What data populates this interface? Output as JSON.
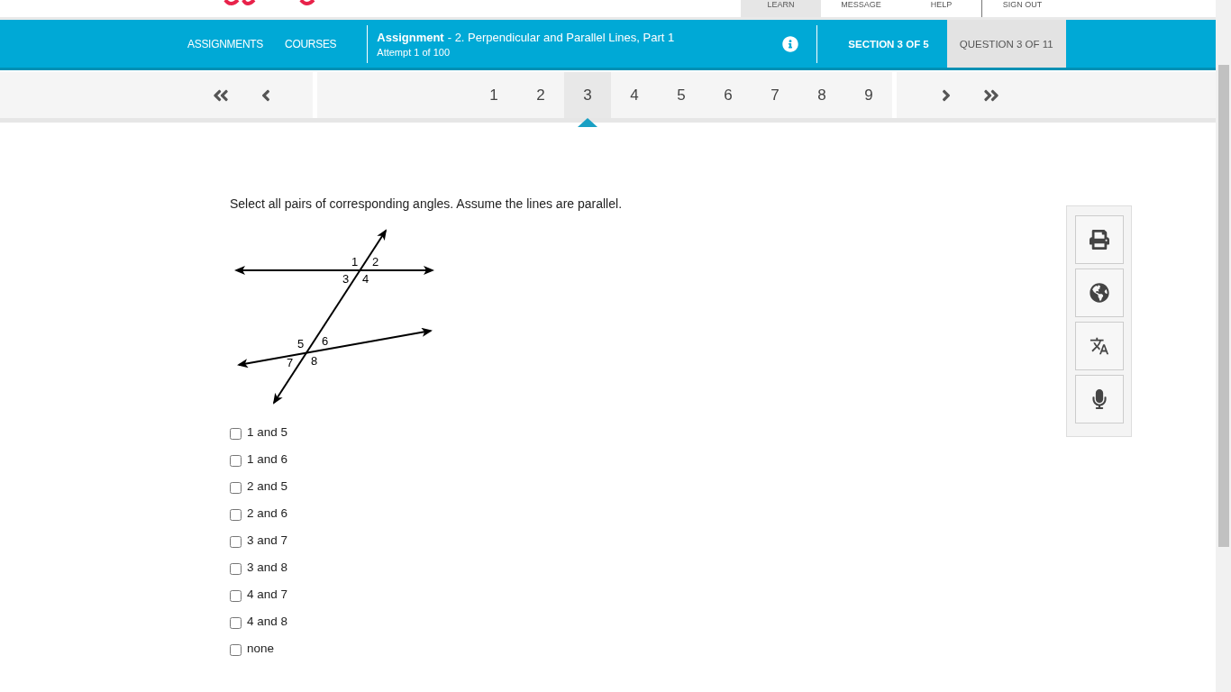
{
  "top_nav": [
    {
      "label": "LEARN",
      "selected": true
    },
    {
      "label": "MESSAGE",
      "selected": false
    },
    {
      "label": "HELP",
      "selected": false
    },
    {
      "label": "SIGN OUT",
      "selected": false
    }
  ],
  "main_nav": {
    "links": [
      "ASSIGNMENTS",
      "COURSES"
    ],
    "assignment_label": "Assignment",
    "assignment_title": "- 2. Perpendicular and Parallel Lines, Part 1",
    "attempt": "Attempt 1 of 100",
    "section": "SECTION 3 OF 5",
    "question": "QUESTION 3 OF 11"
  },
  "pager": [
    {
      "label": "1",
      "selected": false
    },
    {
      "label": "2",
      "selected": false
    },
    {
      "label": "3",
      "selected": true
    },
    {
      "label": "4",
      "selected": false
    },
    {
      "label": "5",
      "selected": false
    },
    {
      "label": "6",
      "selected": false
    },
    {
      "label": "7",
      "selected": false
    },
    {
      "label": "8",
      "selected": false
    },
    {
      "label": "9",
      "selected": false
    }
  ],
  "question": {
    "prompt": "Select all pairs of corresponding angles. Assume the lines are parallel.",
    "diagram_labels": [
      "1",
      "2",
      "3",
      "4",
      "5",
      "6",
      "7",
      "8"
    ],
    "options": [
      {
        "label": "1 and 5",
        "checked": false
      },
      {
        "label": "1 and 6",
        "checked": false
      },
      {
        "label": "2 and 5",
        "checked": false
      },
      {
        "label": "2 and 6",
        "checked": false
      },
      {
        "label": "3 and 7",
        "checked": false
      },
      {
        "label": "3 and 8",
        "checked": false
      },
      {
        "label": "4 and 7",
        "checked": false
      },
      {
        "label": "4 and 8",
        "checked": false
      },
      {
        "label": "none",
        "checked": false
      }
    ]
  }
}
